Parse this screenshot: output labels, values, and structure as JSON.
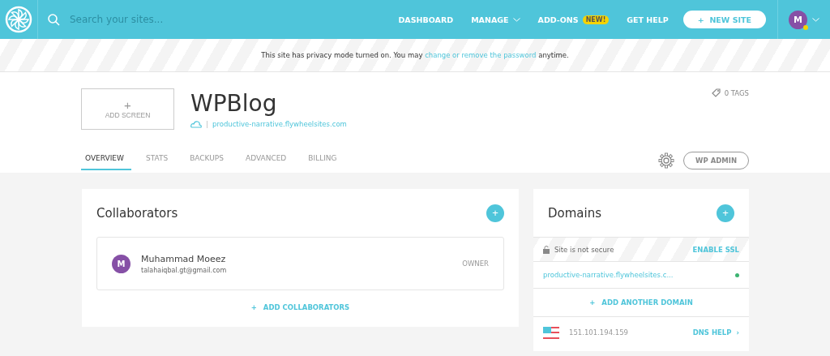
{
  "header": {
    "search": {
      "placeholder": "Search your sites..."
    },
    "nav": [
      {
        "label": "DASHBOARD",
        "kind": "link"
      },
      {
        "label": "MANAGE",
        "kind": "dropdown"
      },
      {
        "label": "ADD-ONS",
        "kind": "badge",
        "badge": "NEW!"
      },
      {
        "label": "GET HELP",
        "kind": "link"
      }
    ],
    "new_site": {
      "icon": "+",
      "label": "NEW SITE"
    },
    "avatar": {
      "initial": "M",
      "color": "#f5d300"
    }
  },
  "privacy_banner": {
    "before": "This site has privacy mode turned on. You may ",
    "link": "change or remove the password",
    "after": " anytime."
  },
  "site": {
    "add_screen": {
      "icon": "+",
      "label": "ADD SCREEN"
    },
    "title": "WPBlog",
    "url": "productive-narrative.flywheelsites.com",
    "tags": "0 TAGS",
    "tabs": [
      {
        "label": "OVERVIEW",
        "selected": true
      },
      {
        "label": "STATS",
        "selected": false
      },
      {
        "label": "BACKUPS",
        "selected": false
      },
      {
        "label": "ADVANCED",
        "selected": false
      },
      {
        "label": "BILLING",
        "selected": false
      }
    ],
    "wp_admin": "WP ADMIN"
  },
  "collaborators": {
    "title": "Collaborators",
    "add_icon": "+",
    "members": [
      {
        "initial": "M",
        "name": "Muhammad Moeez",
        "email": "talahaiqbal.gt@gmail.com",
        "role": "OWNER"
      }
    ],
    "add": {
      "icon": "+",
      "label": "ADD COLLABORATORS"
    }
  },
  "domains": {
    "title": "Domains",
    "add_icon": "+",
    "ssl": {
      "status": "Site is not secure",
      "action": "ENABLE SSL"
    },
    "items": [
      {
        "name": "productive-narrative.flywheelsites.c...",
        "color": "#3cb371"
      }
    ],
    "add": {
      "icon": "+",
      "label": "ADD ANOTHER DOMAIN"
    },
    "ip": "151.101.194.159",
    "dns_help": "DNS HELP",
    "dns_icon": "›"
  }
}
